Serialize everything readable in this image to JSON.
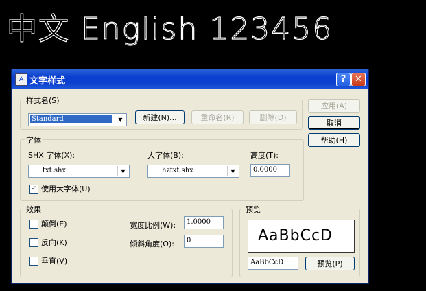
{
  "canvas": {
    "sample_text": "中文 English 123456"
  },
  "dialog": {
    "title": "文字样式",
    "help_label": "?",
    "close_label": "✕",
    "style_name": {
      "group_label": "样式名(S)",
      "selected": "Standard",
      "new_button": "新建(N)...",
      "rename_button": "重命名(R)",
      "delete_button": "删除(D)"
    },
    "side_buttons": {
      "apply": "应用(A)",
      "cancel": "取消",
      "help": "帮助(H)"
    },
    "font": {
      "group_label": "字体",
      "shx_label": "SHX 字体(X):",
      "shx_value": "txt.shx",
      "bigfont_label": "大字体(B):",
      "bigfont_value": "hztxt.shx",
      "height_label": "高度(T):",
      "height_value": "0.0000",
      "use_bigfont_label": "使用大字体(U)",
      "use_bigfont_checked": true
    },
    "effects": {
      "group_label": "效果",
      "upside_down_label": "颠倒(E)",
      "backwards_label": "反向(K)",
      "vertical_label": "垂直(V)",
      "width_factor_label": "宽度比例(W):",
      "width_factor_value": "1.0000",
      "oblique_angle_label": "倾斜角度(O):",
      "oblique_angle_value": "0"
    },
    "preview": {
      "group_label": "预览",
      "sample": "AaBbCcD",
      "input_value": "AaBbCcD",
      "button": "预览(P)"
    }
  }
}
